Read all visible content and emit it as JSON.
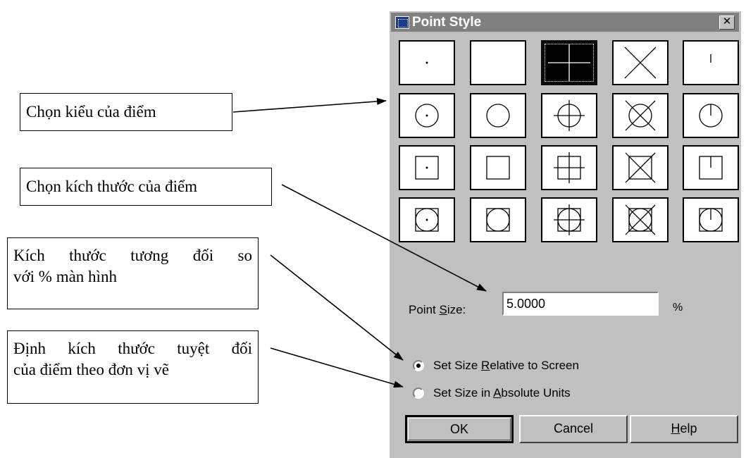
{
  "dialog": {
    "title": "Point Style",
    "close_label": "✕",
    "point_size_label_pre": "Point ",
    "point_size_label_u": "S",
    "point_size_label_post": "ize:",
    "point_size_value": "5.0000",
    "percent_label": "%",
    "radio_relative_pre": "Set Size ",
    "radio_relative_u": "R",
    "radio_relative_post": "elative to Screen",
    "radio_absolute_pre": "Set Size in ",
    "radio_absolute_u": "A",
    "radio_absolute_post": "bsolute Units",
    "selected_radio": "relative",
    "selected_style_index": 2,
    "buttons": {
      "ok": "OK",
      "cancel": "Cancel",
      "help_u": "H",
      "help_post": "elp"
    },
    "title_bar_color": "#808080",
    "face_color": "#c0c0c0"
  },
  "annotations": {
    "style": "Chọn kiểu của điểm",
    "size": "Chọn kích thước của điểm",
    "relative_line1": "Kích thước tương đối so",
    "relative_line2": "với % màn hình",
    "absolute_line1": "Định kích thước tuyệt đối",
    "absolute_line2": "của điểm theo đơn vị vẽ"
  },
  "point_styles": [
    "dot",
    "none",
    "plus",
    "cross",
    "tick",
    "circle-dot",
    "circle",
    "circle-plus",
    "circle-cross",
    "circle-tick",
    "square-dot",
    "square",
    "square-plus",
    "square-cross",
    "square-tick",
    "circle-square-dot",
    "circle-square",
    "circle-square-plus",
    "circle-square-cross",
    "circle-square-tick"
  ]
}
